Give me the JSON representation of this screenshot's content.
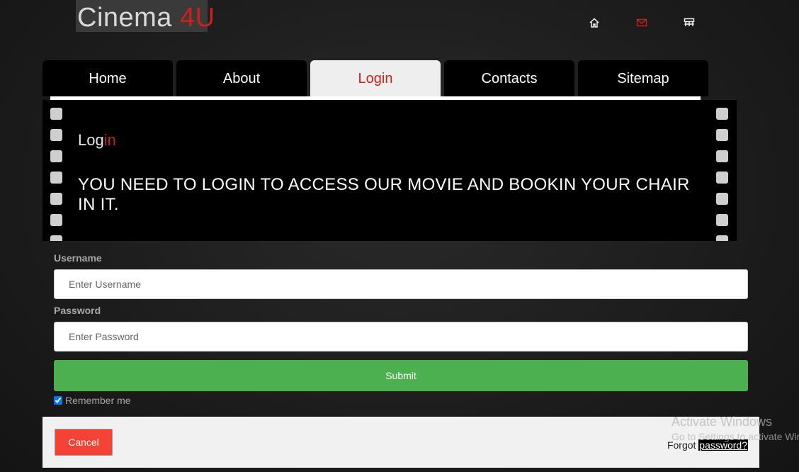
{
  "logo": {
    "part1": "Cinema ",
    "part2": "4U"
  },
  "top_icons": [
    "home-icon",
    "mail-icon",
    "sitemap-icon"
  ],
  "nav": {
    "tabs": [
      {
        "label": "Home",
        "active": false
      },
      {
        "label": "About",
        "active": false
      },
      {
        "label": "Login",
        "active": true
      },
      {
        "label": "Contacts",
        "active": false
      },
      {
        "label": "Sitemap",
        "active": false
      }
    ]
  },
  "banner": {
    "title_part1": "Log",
    "title_part2": "in",
    "message": "YOU NEED TO LOGIN TO ACCESS OUR MOVIE AND BOOKIN YOUR CHAIR IN IT."
  },
  "form": {
    "username_label": "Username",
    "username_placeholder": "Enter Username",
    "password_label": "Password",
    "password_placeholder": "Enter Password",
    "submit_label": "Submit",
    "remember_label": "Remember me",
    "remember_checked": true
  },
  "footer": {
    "cancel_label": "Cancel",
    "forgot_prefix": "Forgot ",
    "forgot_link": "password?"
  },
  "watermark": {
    "line1": "Activate Windows",
    "line2": "Go to Settings to activate Windows."
  },
  "colors": {
    "accent_red": "#c9221a",
    "submit_green": "#4caf50",
    "cancel_red": "#f44336",
    "active_tab_bg": "#eeeeee"
  }
}
